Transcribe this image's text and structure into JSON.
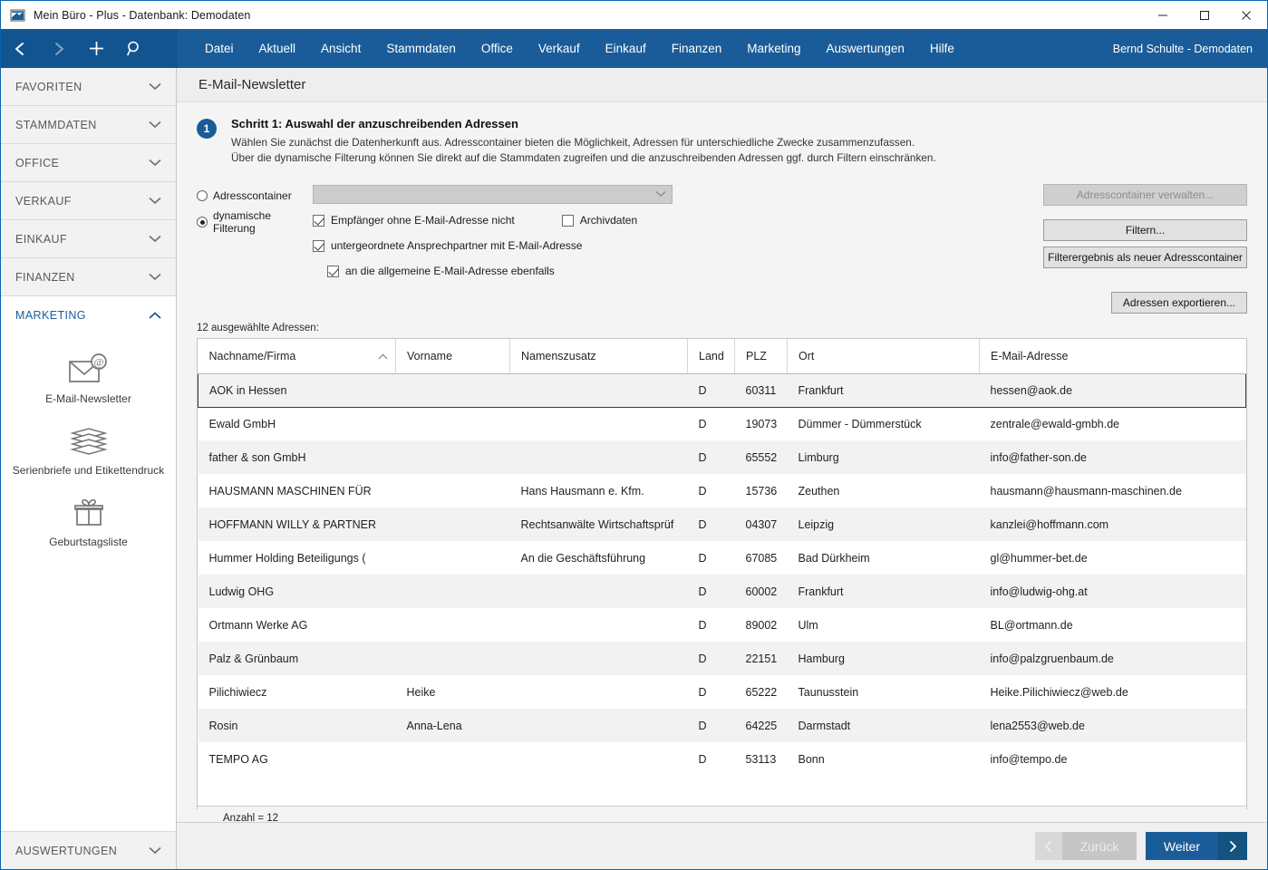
{
  "window": {
    "title": "Mein Büro - Plus - Datenbank: Demodaten",
    "minimize": "–",
    "maximize": "□",
    "close": "✕"
  },
  "menubar": {
    "items": [
      {
        "label": "Datei"
      },
      {
        "label": "Aktuell"
      },
      {
        "label": "Ansicht"
      },
      {
        "label": "Stammdaten"
      },
      {
        "label": "Office"
      },
      {
        "label": "Verkauf"
      },
      {
        "label": "Einkauf"
      },
      {
        "label": "Finanzen"
      },
      {
        "label": "Marketing"
      },
      {
        "label": "Auswertungen"
      },
      {
        "label": "Hilfe"
      }
    ],
    "user": "Bernd Schulte - Demodaten",
    "nav_icons": [
      "back-arrow-icon",
      "forward-arrow-icon",
      "plus-icon",
      "search-icon"
    ]
  },
  "sidebar": {
    "groups": [
      {
        "label": "FAVORITEN",
        "expanded": false
      },
      {
        "label": "STAMMDATEN",
        "expanded": false
      },
      {
        "label": "OFFICE",
        "expanded": false
      },
      {
        "label": "VERKAUF",
        "expanded": false
      },
      {
        "label": "EINKAUF",
        "expanded": false
      },
      {
        "label": "FINANZEN",
        "expanded": false
      },
      {
        "label": "MARKETING",
        "expanded": true
      }
    ],
    "marketing_entries": [
      {
        "label": "E-Mail-Newsletter",
        "icon": "envelope-at-icon"
      },
      {
        "label": "Serienbriefe und Etikettendruck",
        "icon": "stacked-papers-icon"
      },
      {
        "label": "Geburtstagsliste",
        "icon": "gift-icon"
      }
    ],
    "bottom_group": {
      "label": "AUSWERTUNGEN",
      "expanded": false
    }
  },
  "page": {
    "title": "E-Mail-Newsletter"
  },
  "step": {
    "number": "1",
    "title": "Schritt 1: Auswahl der anzuschreibenden Adressen",
    "line1": "Wählen Sie zunächst die Datenherkunft aus. Adresscontainer bieten die Möglichkeit, Adressen für unterschiedliche Zwecke zusammenzufassen.",
    "line2": "Über die dynamische Filterung können Sie direkt auf die Stammdaten zugreifen und die anzuschreibenden Adressen ggf. durch Filtern einschränken."
  },
  "form": {
    "radio_container_label": "Adresscontainer",
    "radio_container_selected": false,
    "radio_dynamic_label": "dynamische Filterung",
    "radio_dynamic_selected": true,
    "container_dropdown_value": "",
    "checkboxes": [
      {
        "label": "Empfänger ohne E-Mail-Adresse nicht",
        "checked": true
      },
      {
        "label": "Archivdaten",
        "checked": false
      },
      {
        "label": "untergeordnete Ansprechpartner mit E-Mail-Adresse",
        "checked": true
      },
      {
        "label": "an die allgemeine E-Mail-Adresse ebenfalls",
        "checked": true
      }
    ],
    "buttons": {
      "manage_container": "Adresscontainer verwalten...",
      "manage_container_disabled": true,
      "filter": "Filtern...",
      "filter_as_container": "Filterergebnis als neuer Adresscontainer",
      "export": "Adressen exportieren..."
    }
  },
  "table": {
    "selection_caption": "12 ausgewählte Adressen:",
    "columns": [
      {
        "label": "Nachname/Firma",
        "sorted": "asc"
      },
      {
        "label": "Vorname",
        "sorted": ""
      },
      {
        "label": "Namenszusatz",
        "sorted": ""
      },
      {
        "label": "Land",
        "sorted": ""
      },
      {
        "label": "PLZ",
        "sorted": ""
      },
      {
        "label": "Ort",
        "sorted": ""
      },
      {
        "label": "E-Mail-Adresse",
        "sorted": ""
      }
    ],
    "rows": [
      {
        "name": "AOK in Hessen",
        "vorname": "",
        "zusatz": "",
        "land": "D",
        "plz": "60311",
        "ort": "Frankfurt",
        "email": "hessen@aok.de",
        "selected": true
      },
      {
        "name": "Ewald GmbH",
        "vorname": "",
        "zusatz": "",
        "land": "D",
        "plz": "19073",
        "ort": "Dümmer - Dümmerstück",
        "email": "zentrale@ewald-gmbh.de",
        "selected": false
      },
      {
        "name": "father & son GmbH",
        "vorname": "",
        "zusatz": "",
        "land": "D",
        "plz": "65552",
        "ort": "Limburg",
        "email": "info@father-son.de",
        "selected": false
      },
      {
        "name": "HAUSMANN MASCHINEN FÜR",
        "vorname": "",
        "zusatz": "Hans Hausmann e. Kfm.",
        "land": "D",
        "plz": "15736",
        "ort": "Zeuthen",
        "email": "hausmann@hausmann-maschinen.de",
        "selected": false
      },
      {
        "name": "HOFFMANN WILLY & PARTNER",
        "vorname": "",
        "zusatz": "Rechtsanwälte Wirtschaftsprüf",
        "land": "D",
        "plz": "04307",
        "ort": "Leipzig",
        "email": "kanzlei@hoffmann.com",
        "selected": false
      },
      {
        "name": "Hummer Holding Beteiligungs (",
        "vorname": "",
        "zusatz": "An die Geschäftsführung",
        "land": "D",
        "plz": "67085",
        "ort": "Bad Dürkheim",
        "email": "gl@hummer-bet.de",
        "selected": false
      },
      {
        "name": "Ludwig OHG",
        "vorname": "",
        "zusatz": "",
        "land": "D",
        "plz": "60002",
        "ort": "Frankfurt",
        "email": "info@ludwig-ohg.at",
        "selected": false
      },
      {
        "name": "Ortmann Werke AG",
        "vorname": "",
        "zusatz": "",
        "land": "D",
        "plz": "89002",
        "ort": "Ulm",
        "email": "BL@ortmann.de",
        "selected": false
      },
      {
        "name": "Palz & Grünbaum",
        "vorname": "",
        "zusatz": "",
        "land": "D",
        "plz": "22151",
        "ort": "Hamburg",
        "email": "info@palzgruenbaum.de",
        "selected": false
      },
      {
        "name": "Pilichiwiecz",
        "vorname": "Heike",
        "zusatz": "",
        "land": "D",
        "plz": "65222",
        "ort": "Taunusstein",
        "email": "Heike.Pilichiwiecz@web.de",
        "selected": false
      },
      {
        "name": "Rosin",
        "vorname": "Anna-Lena",
        "zusatz": "",
        "land": "D",
        "plz": "64225",
        "ort": "Darmstadt",
        "email": "lena2553@web.de",
        "selected": false
      },
      {
        "name": "TEMPO AG",
        "vorname": "",
        "zusatz": "",
        "land": "D",
        "plz": "53113",
        "ort": "Bonn",
        "email": "info@tempo.de",
        "selected": false
      }
    ],
    "footer_count": "Anzahl = 12"
  },
  "wizard": {
    "back_label": "Zurück",
    "back_disabled": true,
    "next_label": "Weiter"
  },
  "colors": {
    "accent": "#1a5c99",
    "accent_dark": "#12548f",
    "sidebar_group_bg": "#f2f2f2",
    "page_bg": "#f4f4f4"
  }
}
